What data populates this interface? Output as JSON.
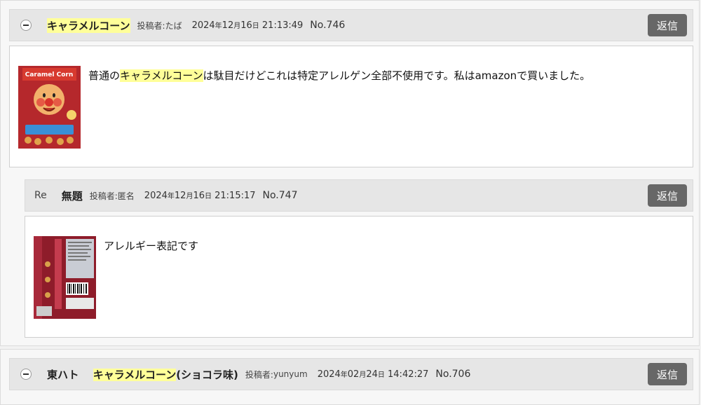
{
  "posts": [
    {
      "title": "キャラメルコーン",
      "author_label": "投稿者:",
      "author": "たば",
      "date_y": "2024",
      "date_y_unit": "年",
      "date_m": "12",
      "date_m_unit": "月",
      "date_d": "16",
      "date_d_unit": "日",
      "time": "21:13:49",
      "no": "No.746",
      "reply_label": "返信",
      "body_pre": "普通の",
      "body_hl": "キャラメルコーン",
      "body_post": "は駄目だけどこれは特定アレルゲン全部不使用です。私はamazonで買いました。",
      "image_alt": "アンパンマン キャラメルコーン"
    },
    {
      "re_label": "Re",
      "title": "無題",
      "author_label": "投稿者:",
      "author": "匿名",
      "date_y": "2024",
      "date_y_unit": "年",
      "date_m": "12",
      "date_m_unit": "月",
      "date_d": "16",
      "date_d_unit": "日",
      "time": "21:15:17",
      "no": "No.747",
      "reply_label": "返信",
      "body": "アレルギー表記です",
      "image_alt": "パッケージ裏面"
    },
    {
      "title_pre": "東ハト",
      "title_hl": "キャラメルコーン",
      "title_post": "(ショコラ味)",
      "author_label": "投稿者:",
      "author": "yunyum",
      "date_y": "2024",
      "date_y_unit": "年",
      "date_m": "02",
      "date_m_unit": "月",
      "date_d": "24",
      "date_d_unit": "日",
      "time": "14:42:27",
      "no": "No.706",
      "reply_label": "返信"
    }
  ],
  "colors": {
    "highlight": "#ffff99",
    "reply_button": "#676767",
    "header_bg": "#e6e6e6"
  }
}
